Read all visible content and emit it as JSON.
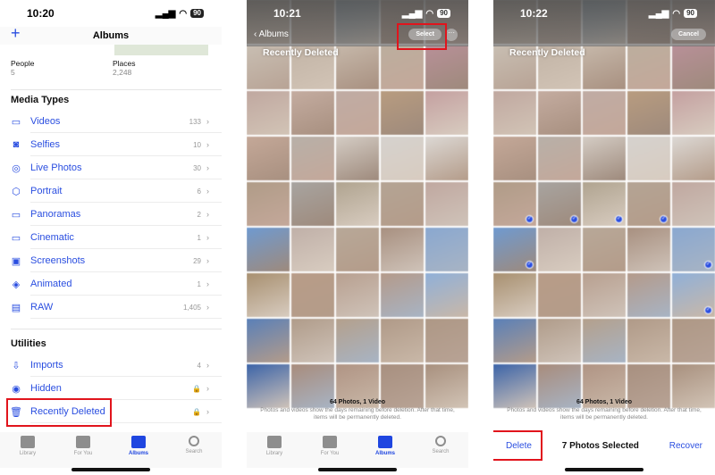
{
  "colors": {
    "accent": "#2a4ee0",
    "highlight": "#e1141c"
  },
  "screen1": {
    "time": "10:20",
    "battery": "90",
    "title": "Albums",
    "add_icon": "plus-icon",
    "people": {
      "label": "People",
      "count": "5"
    },
    "places": {
      "label": "Places",
      "count": "2,248"
    },
    "media_header": "Media Types",
    "media": [
      {
        "label": "Videos",
        "count": "133",
        "icon": "video-icon"
      },
      {
        "label": "Selfies",
        "count": "10",
        "icon": "selfie-icon"
      },
      {
        "label": "Live Photos",
        "count": "30",
        "icon": "live-photo-icon"
      },
      {
        "label": "Portrait",
        "count": "6",
        "icon": "portrait-cube-icon"
      },
      {
        "label": "Panoramas",
        "count": "2",
        "icon": "panorama-icon"
      },
      {
        "label": "Cinematic",
        "count": "1",
        "icon": "cinematic-icon"
      },
      {
        "label": "Screenshots",
        "count": "29",
        "icon": "screenshot-icon"
      },
      {
        "label": "Animated",
        "count": "1",
        "icon": "animated-icon"
      },
      {
        "label": "RAW",
        "count": "1,405",
        "icon": "raw-icon"
      }
    ],
    "utilities_header": "Utilities",
    "utilities": [
      {
        "label": "Imports",
        "count": "4",
        "icon": "import-icon"
      },
      {
        "label": "Hidden",
        "count": "🔒",
        "icon": "eye-slash-icon"
      },
      {
        "label": "Recently Deleted",
        "count": "🔒",
        "icon": "trash-icon"
      }
    ],
    "tabs": [
      {
        "label": "Library"
      },
      {
        "label": "For You"
      },
      {
        "label": "Albums"
      },
      {
        "label": "Search"
      }
    ]
  },
  "screen2": {
    "time": "10:21",
    "battery": "90",
    "back_label": "Albums",
    "select_label": "Select",
    "more_label": "···",
    "title": "Recently Deleted",
    "summary": "64 Photos, 1 Video",
    "note": "Photos and videos show the days remaining before deletion. After that time, items will be permanently deleted.",
    "tabs": [
      {
        "label": "Library"
      },
      {
        "label": "For You"
      },
      {
        "label": "Albums"
      },
      {
        "label": "Search"
      }
    ]
  },
  "screen3": {
    "time": "10:22",
    "battery": "90",
    "cancel_label": "Cancel",
    "title": "Recently Deleted",
    "summary": "64 Photos, 1 Video",
    "note": "Photos and videos show the days remaining before deletion. After that time, items will be permanently deleted.",
    "delete_label": "Delete",
    "selected_label": "7 Photos Selected",
    "recover_label": "Recover",
    "selected_count": 7
  }
}
